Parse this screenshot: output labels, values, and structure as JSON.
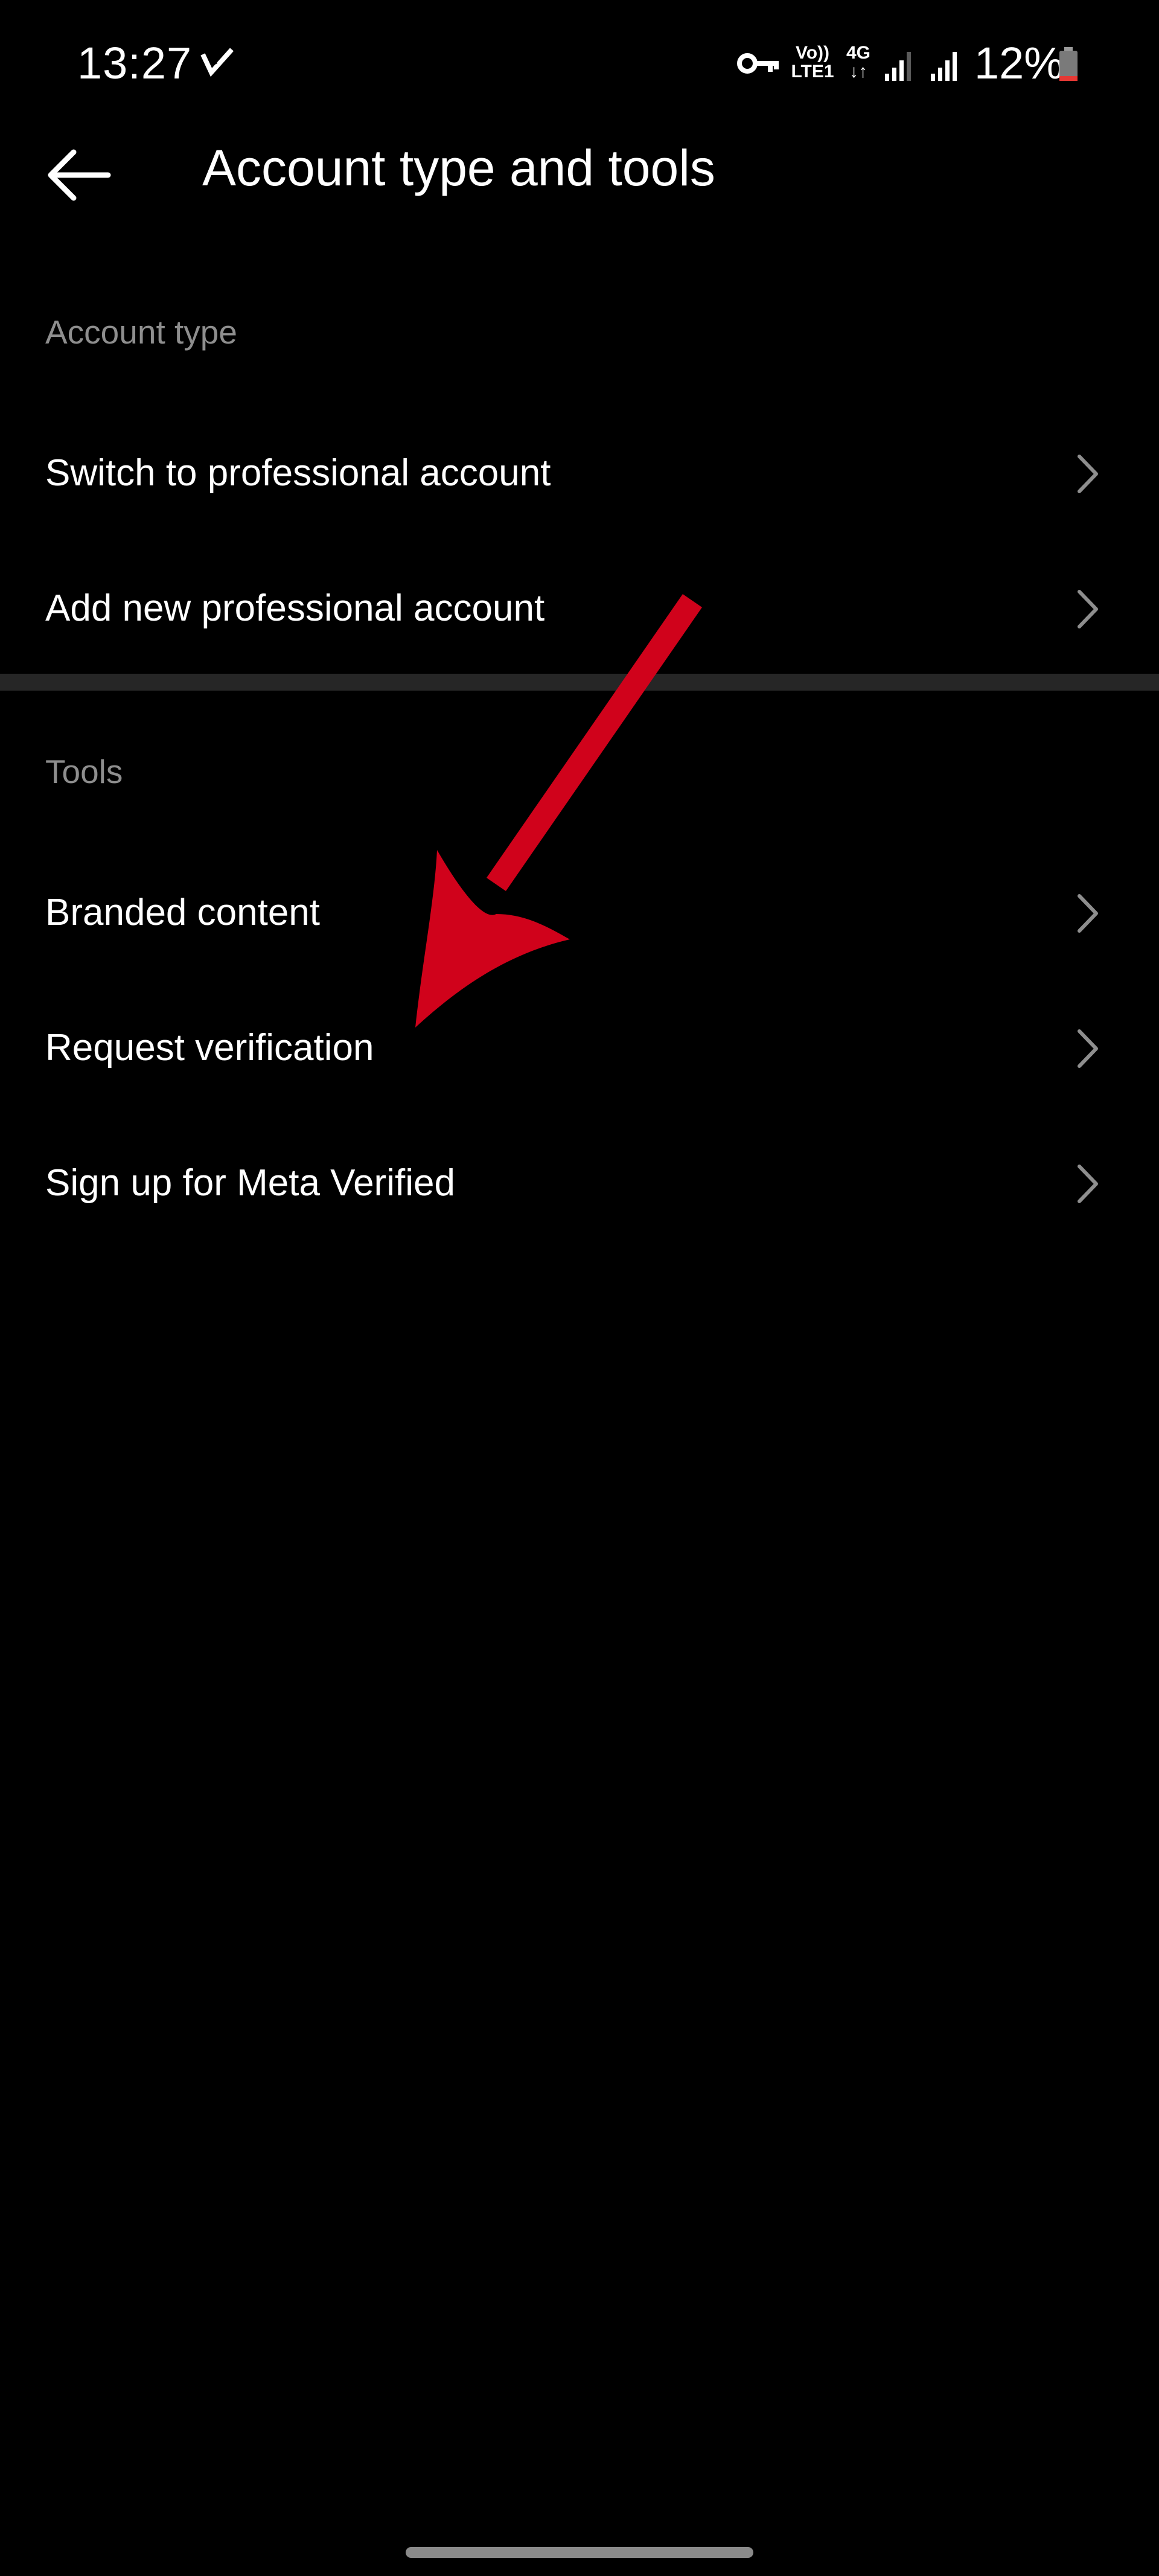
{
  "status_bar": {
    "time": "13:27",
    "volte_top": "Vo))",
    "volte_bottom": "LTE1",
    "network_top": "4G",
    "network_bottom": "↓↑",
    "battery_percent": "12%",
    "icons": [
      "delivery-check-icon",
      "vpn-key-icon",
      "signal-icon",
      "signal-icon",
      "battery-icon"
    ],
    "battery_level_color": "#e53935"
  },
  "header": {
    "title": "Account type and tools",
    "back_icon": "arrow-left-icon"
  },
  "sections": [
    {
      "title": "Account type",
      "items": [
        {
          "label": "Switch to professional account"
        },
        {
          "label": "Add new professional account"
        }
      ]
    },
    {
      "title": "Tools",
      "items": [
        {
          "label": "Branded content"
        },
        {
          "label": "Request verification"
        },
        {
          "label": "Sign up for Meta Verified"
        }
      ]
    }
  ],
  "annotation": {
    "type": "arrow",
    "color": "#d0021b",
    "points_to": "Request verification"
  },
  "colors": {
    "background": "#000000",
    "text_primary": "#ffffff",
    "text_secondary": "#8e8e8e",
    "divider": "#262626",
    "chevron": "#8e8e8e"
  }
}
